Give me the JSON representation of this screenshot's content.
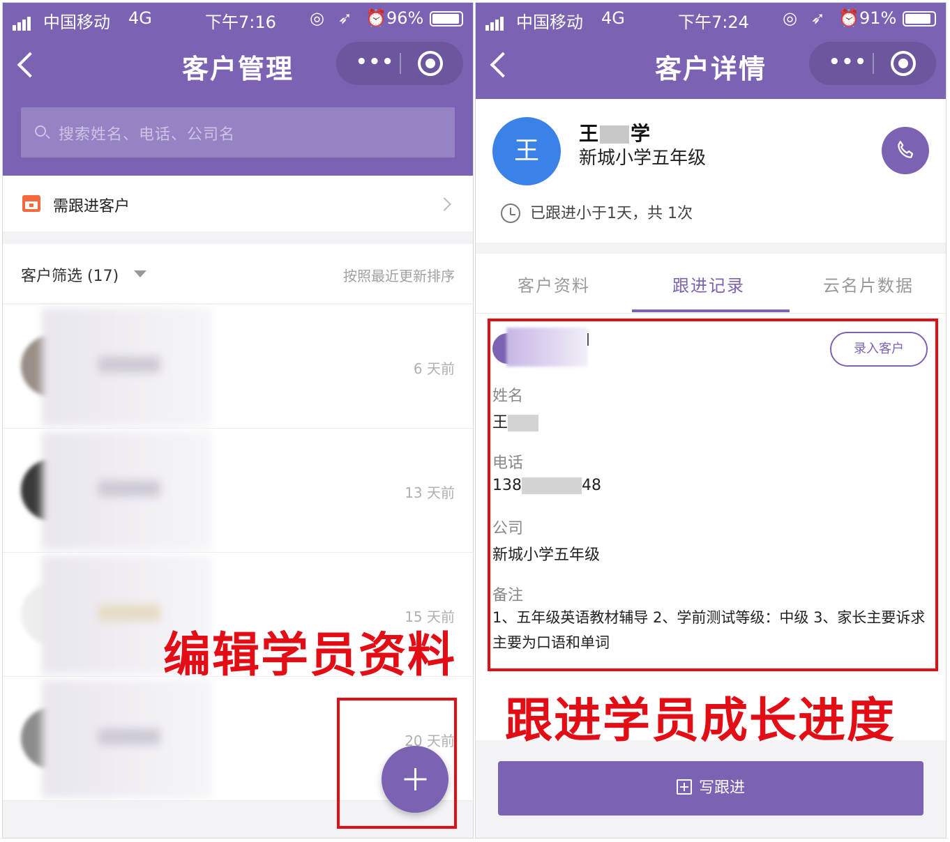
{
  "left": {
    "status": {
      "carrier": "中国移动",
      "network": "4G",
      "time": "下午7:16",
      "icons": "◎ ➶ ⏰",
      "battery": "96%",
      "battery_level": 0.96
    },
    "nav": {
      "title": "客户管理",
      "more": "•••"
    },
    "search": {
      "placeholder": "搜索姓名、电话、公司名"
    },
    "follow_row": {
      "label": "需跟进客户"
    },
    "filter": {
      "label": "客户筛选 (17)",
      "sort": "按照最近更新排序"
    },
    "customers": [
      {
        "days": "6 天前"
      },
      {
        "days": "13 天前"
      },
      {
        "days": "15 天前"
      },
      {
        "days": "20 天前"
      }
    ],
    "annotation": "编辑学员资料"
  },
  "right": {
    "status": {
      "carrier": "中国移动",
      "network": "4G",
      "time": "下午7:24",
      "icons": "◎ ➶ ⏰",
      "battery": "91%",
      "battery_level": 0.91
    },
    "nav": {
      "title": "客户详情",
      "more": "•••"
    },
    "profile": {
      "avatar_char": "王",
      "name_first": "王",
      "name_last": "学",
      "company": "新城小学五年级",
      "follow_status": "已跟进小于1天，共 1次"
    },
    "tabs": [
      "客户资料",
      "跟进记录",
      "云名片数据"
    ],
    "record": {
      "enter_button": "录入客户",
      "name_label": "姓名",
      "name_value": "王",
      "phone_label": "电话",
      "phone_prefix": "138",
      "phone_suffix": "48",
      "company_label": "公司",
      "company_value": "新城小学五年级",
      "remark_label": "备注",
      "remark_value": "1、五年级英语教材辅导 2、学前测试等级：中级 3、家长主要诉求主要为口语和单词"
    },
    "write_button": "写跟进",
    "annotation": "跟进学员成长进度"
  },
  "colors": {
    "primary": "#7b62b3",
    "avatar_blue": "#3b82e8",
    "annotation_red": "#e30d16"
  }
}
